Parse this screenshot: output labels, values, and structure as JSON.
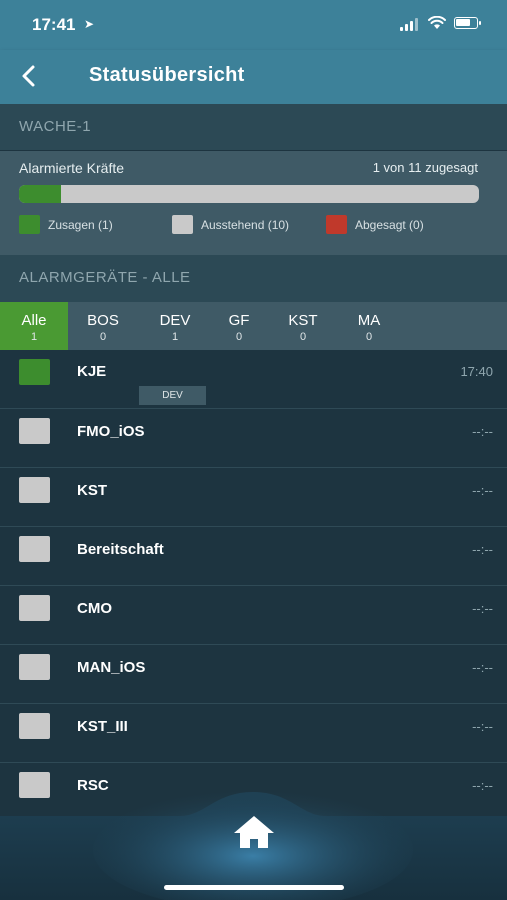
{
  "status_bar": {
    "time": "17:41"
  },
  "nav": {
    "title": "Statusübersicht"
  },
  "section1": {
    "title": "WACHE-1"
  },
  "alarm": {
    "label": "Alarmierte Kräfte",
    "count_text": "1 von 11 zugesagt",
    "progress_fraction": 0.091,
    "legend": [
      {
        "label": "Zusagen (1)",
        "color": "#3d8d2e"
      },
      {
        "label": "Ausstehend (10)",
        "color": "#c9c9c9"
      },
      {
        "label": "Abgesagt (0)",
        "color": "#c0392b"
      }
    ]
  },
  "section2": {
    "title": "ALARMGERÄTE - ALLE"
  },
  "tabs": [
    {
      "label": "Alle",
      "count": "1",
      "active": true
    },
    {
      "label": "BOS",
      "count": "0"
    },
    {
      "label": "DEV",
      "count": "1"
    },
    {
      "label": "GF",
      "count": "0"
    },
    {
      "label": "KST",
      "count": "0"
    },
    {
      "label": "MA",
      "count": "0"
    }
  ],
  "devices": [
    {
      "name": "KJE",
      "time": "17:40",
      "tag": "DEV",
      "status_color": "#3d8d2e"
    },
    {
      "name": "FMO_iOS",
      "time": "--:--",
      "status_color": "#c9c9c9"
    },
    {
      "name": "KST",
      "time": "--:--",
      "status_color": "#c9c9c9"
    },
    {
      "name": "Bereitschaft",
      "time": "--:--",
      "status_color": "#c9c9c9"
    },
    {
      "name": "CMO",
      "time": "--:--",
      "status_color": "#c9c9c9"
    },
    {
      "name": "MAN_iOS",
      "time": "--:--",
      "status_color": "#c9c9c9"
    },
    {
      "name": "KST_III",
      "time": "--:--",
      "status_color": "#c9c9c9"
    },
    {
      "name": "RSC",
      "time": "--:--",
      "status_color": "#c9c9c9"
    }
  ],
  "bottom_nav": {
    "icon": "home-icon"
  },
  "colors": {
    "header": "#3d8199",
    "accent_green": "#4a9a33",
    "background": "#1d3440"
  }
}
